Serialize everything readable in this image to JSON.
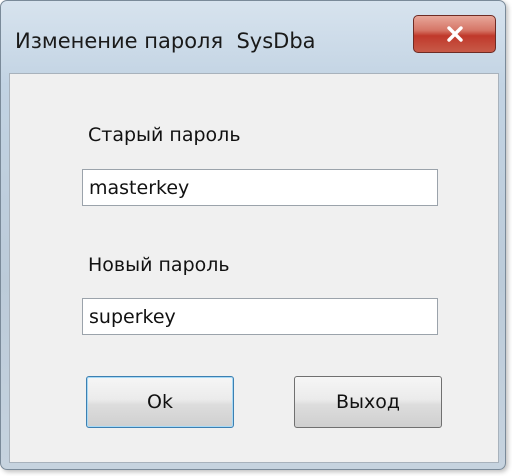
{
  "window": {
    "title": "Изменение пароля  SysDba"
  },
  "form": {
    "old_password_label": "Старый пароль",
    "old_password_value": "masterkey",
    "new_password_label": "Новый пароль",
    "new_password_value": "superkey"
  },
  "buttons": {
    "ok_label": "Ok",
    "exit_label": "Выход"
  },
  "icons": {
    "close": "close-icon"
  },
  "colors": {
    "close_button": "#c0392b",
    "client_background": "#f0f0f0",
    "frame": "#bccbd9"
  }
}
